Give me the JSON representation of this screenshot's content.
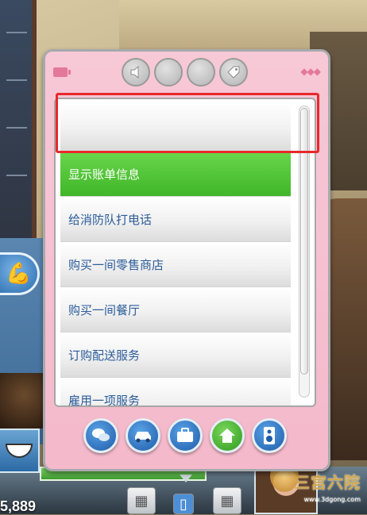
{
  "hud": {
    "funds": "5,889"
  },
  "phone": {
    "top_buttons": [
      {
        "icon": "speaker-icon"
      },
      {
        "icon": "blank-icon"
      },
      {
        "icon": "blank-icon"
      },
      {
        "icon": "tag-icon"
      }
    ],
    "menu_items": [
      {
        "label": ""
      },
      {
        "label": "显示账单信息",
        "selected": true
      },
      {
        "label": "给消防队打电话"
      },
      {
        "label": "购买一间零售商店"
      },
      {
        "label": "购买一间餐厅"
      },
      {
        "label": "订购配送服务"
      },
      {
        "label": "雇用一项服务"
      }
    ],
    "bottom_buttons": [
      {
        "icon": "chat-bubbles-icon"
      },
      {
        "icon": "car-icon"
      },
      {
        "icon": "briefcase-icon"
      },
      {
        "icon": "home-icon"
      },
      {
        "icon": "speaker-icon"
      }
    ]
  },
  "watermark": {
    "text": "三宫六院",
    "sub": "www.3dgong.com"
  },
  "colors": {
    "selected_item": "#3fb628",
    "highlight_box": "#e8282b",
    "panel_pink": "#f7c8d6"
  }
}
